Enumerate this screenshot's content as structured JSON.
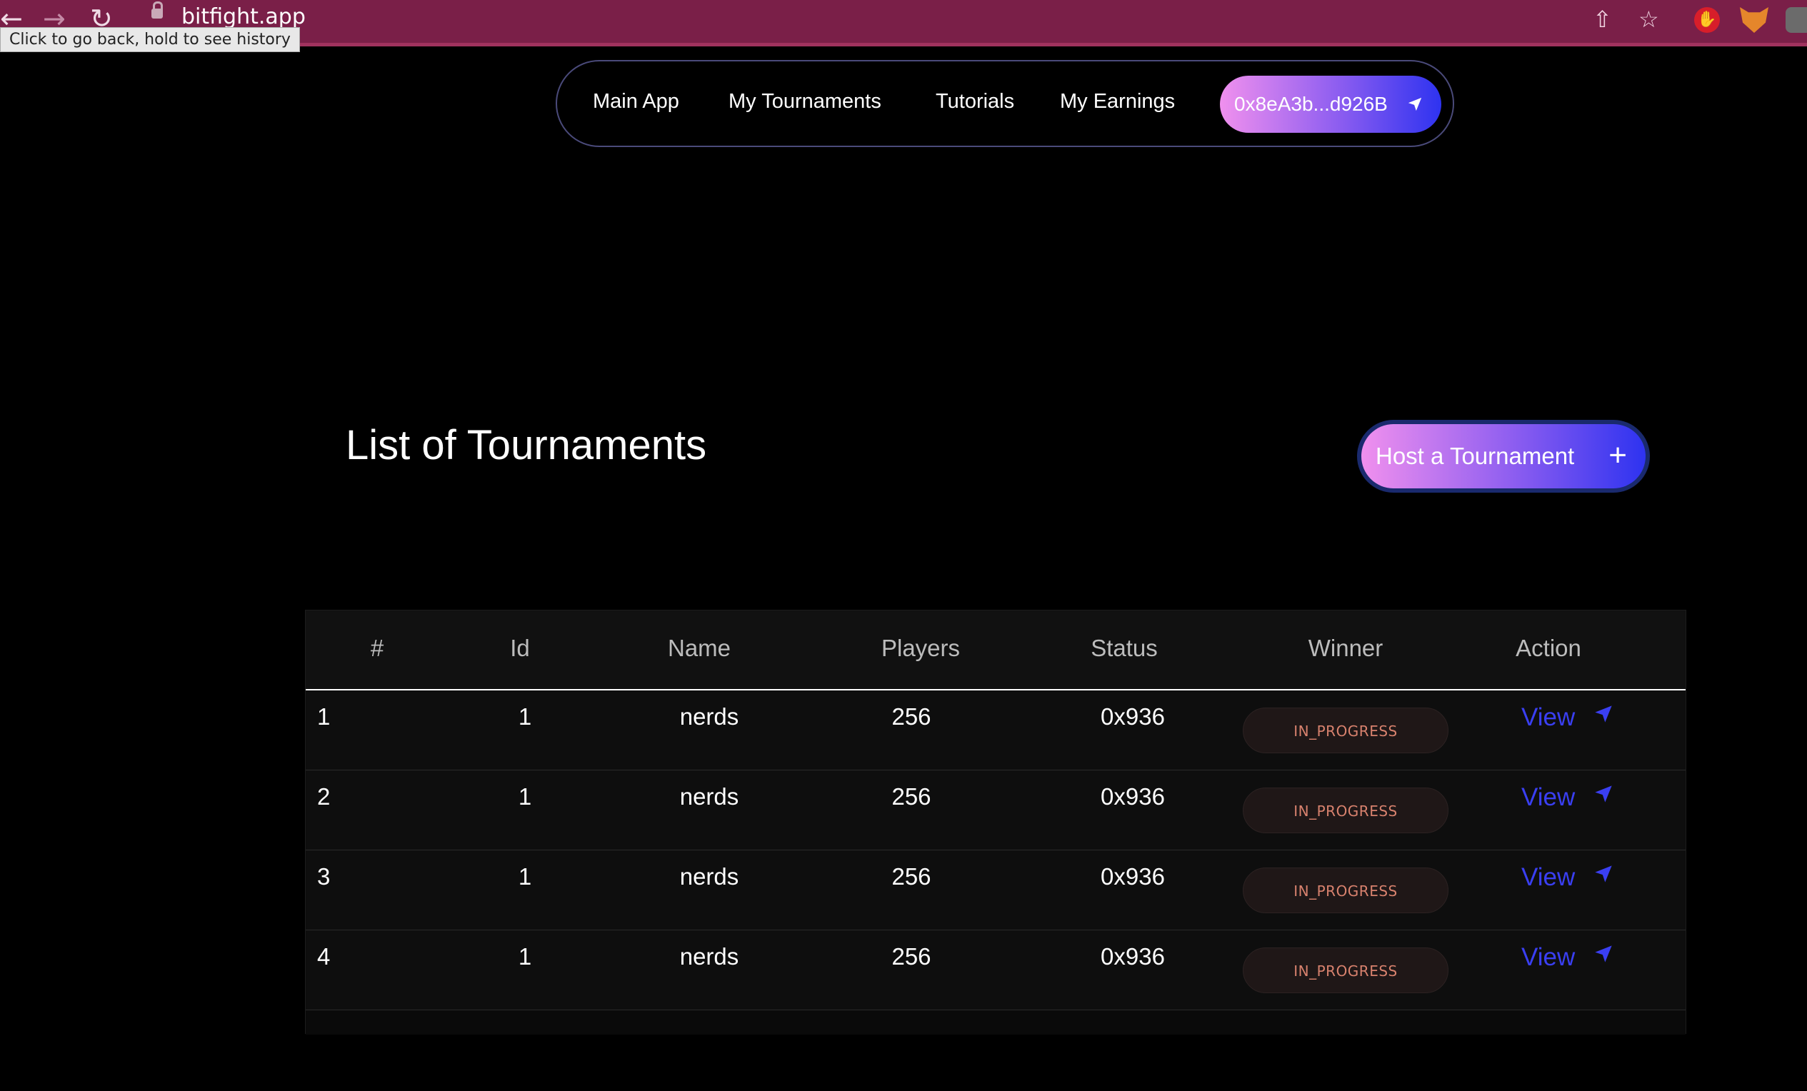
{
  "browser": {
    "url": "bitfight.app",
    "back_tooltip": "Click to go back, hold to see history"
  },
  "nav": {
    "links": [
      "Main App",
      "My Tournaments",
      "Tutorials",
      "My Earnings"
    ],
    "wallet": "0x8eA3b...d926B"
  },
  "page": {
    "title": "List of Tournaments",
    "host_button": "Host a Tournament"
  },
  "table": {
    "headers": [
      "#",
      "Id",
      "Name",
      "Players",
      "Status",
      "Winner",
      "Action"
    ],
    "rows": [
      {
        "num": "1",
        "id": "1",
        "name": "nerds",
        "players": "256",
        "status": "0x936",
        "winner": "IN_PROGRESS",
        "action": "View"
      },
      {
        "num": "2",
        "id": "1",
        "name": "nerds",
        "players": "256",
        "status": "0x936",
        "winner": "IN_PROGRESS",
        "action": "View"
      },
      {
        "num": "3",
        "id": "1",
        "name": "nerds",
        "players": "256",
        "status": "0x936",
        "winner": "IN_PROGRESS",
        "action": "View"
      },
      {
        "num": "4",
        "id": "1",
        "name": "nerds",
        "players": "256",
        "status": "0x936",
        "winner": "IN_PROGRESS",
        "action": "View"
      }
    ]
  },
  "colors": {
    "chrome": "#7a1f48",
    "accent_blue": "#3a3ff2",
    "gradient_start": "#f090ee",
    "gradient_end": "#2e33f0",
    "badge_text": "#d8826e"
  }
}
